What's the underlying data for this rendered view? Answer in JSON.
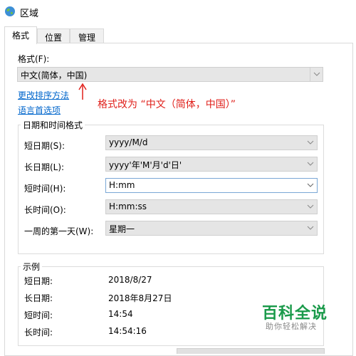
{
  "window": {
    "title": "区域"
  },
  "tabs": [
    {
      "label": "格式"
    },
    {
      "label": "位置"
    },
    {
      "label": "管理"
    }
  ],
  "format": {
    "label": "格式(F):",
    "value": "中文(简体，中国)"
  },
  "links": {
    "sort": "更改排序方法",
    "language": "语言首选项"
  },
  "annotation": "格式改为 “中文（简体，中国）”",
  "datetime_group": {
    "title": "日期和时间格式",
    "rows": [
      {
        "label": "短日期(S):",
        "value": "yyyy/M/d"
      },
      {
        "label": "长日期(L):",
        "value": "yyyy'年'M'月'd'日'"
      },
      {
        "label": "短时间(H):",
        "value": "H:mm"
      },
      {
        "label": "长时间(O):",
        "value": "H:mm:ss"
      },
      {
        "label": "一周的第一天(W):",
        "value": "星期一"
      }
    ]
  },
  "examples_group": {
    "title": "示例",
    "rows": [
      {
        "label": "短日期:",
        "value": "2018/8/27"
      },
      {
        "label": "长日期:",
        "value": "2018年8月27日"
      },
      {
        "label": "短时间:",
        "value": "14:54"
      },
      {
        "label": "长时间:",
        "value": "14:54:16"
      }
    ]
  },
  "watermark": {
    "title": "百科全说",
    "subtitle": "助你轻松解决"
  },
  "colors": {
    "link": "#0066cc",
    "annotation": "#e0201b",
    "watermark": "#1a9a4a"
  }
}
